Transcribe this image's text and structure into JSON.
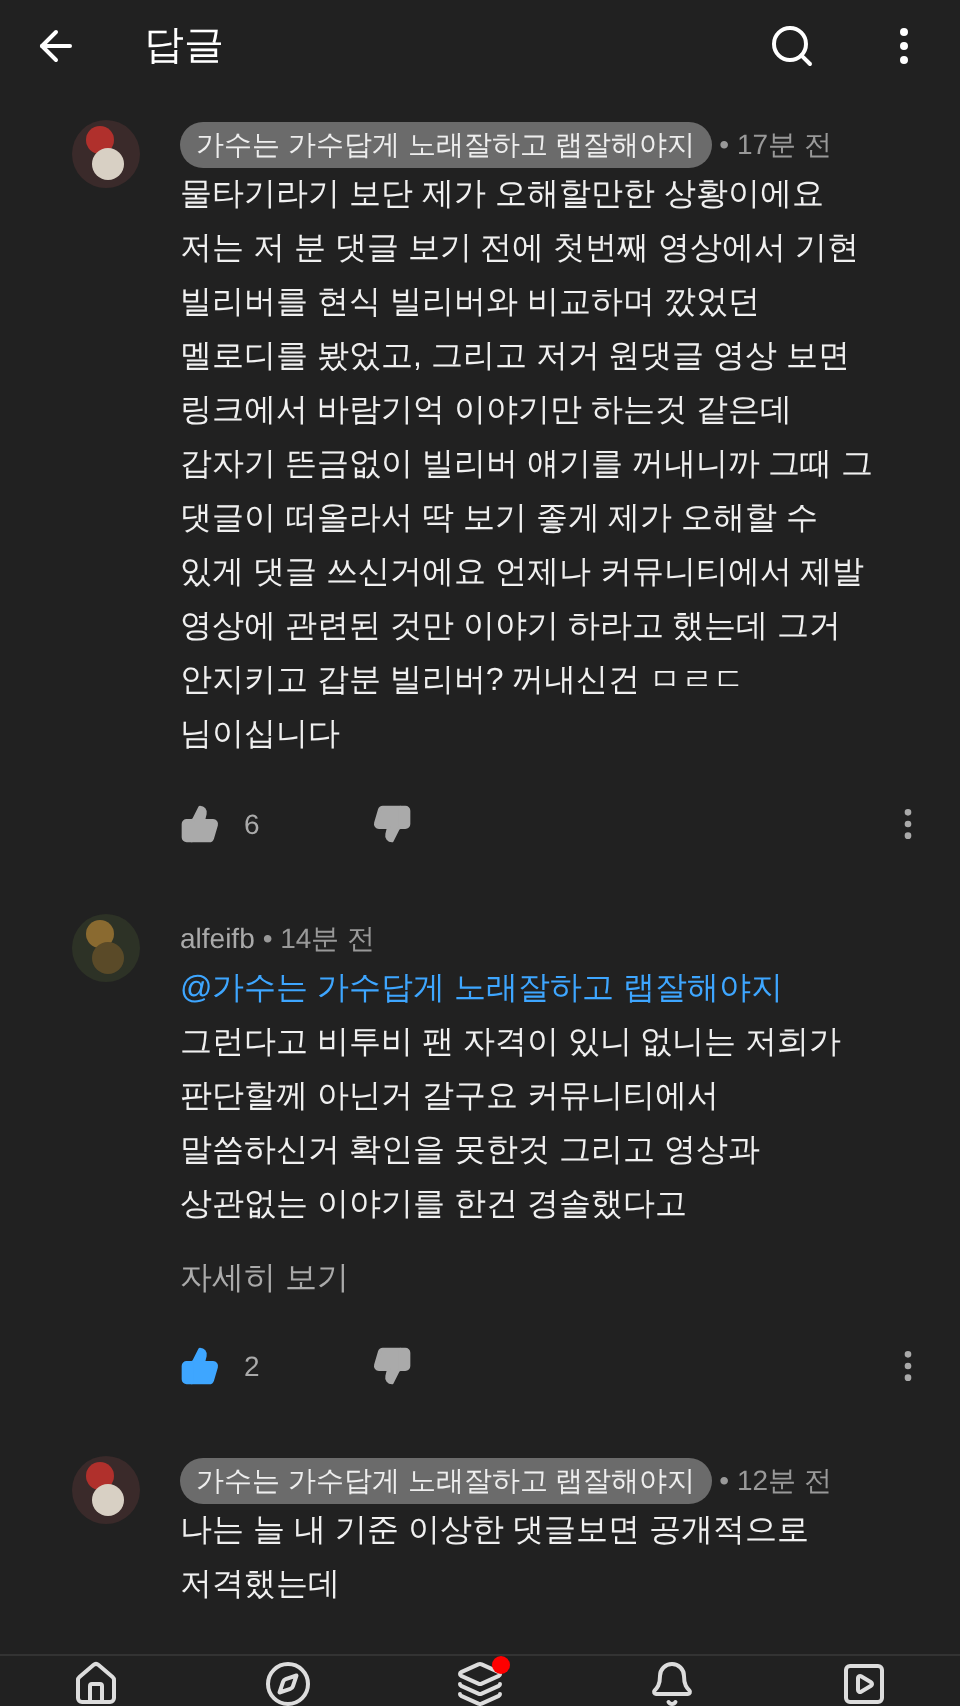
{
  "header": {
    "title": "답글"
  },
  "comments": [
    {
      "author": "가수는 가수답게 노래잘하고 랩잘해야지",
      "author_highlighted": true,
      "time": "• 17분 전",
      "body": "물타기라기 보단 제가 오해할만한 상황이에요\n저는 저 분 댓글 보기 전에 첫번째 영상에서 기현\n빌리버를 현식 빌리버와 비교하며 깠었던\n멜로디를 봤었고, 그리고 저거 원댓글 영상 보면\n링크에서 바람기억 이야기만 하는것 같은데\n갑자기 뜬금없이 빌리버 얘기를 꺼내니까 그때 그\n댓글이 떠올라서 딱 보기 좋게 제가 오해할 수\n있게 댓글 쓰신거에요 언제나 커뮤니티에서 제발\n영상에 관련된 것만 이야기 하라고 했는데 그거\n안지키고 갑분 빌리버? 꺼내신건 ㅁㄹㄷ\n님이십니다",
      "likes": "6",
      "liked": false
    },
    {
      "author": "alfeifb",
      "author_highlighted": false,
      "time": "• 14분 전",
      "mention": "@가수는 가수답게 노래잘하고 랩잘해야지",
      "body": "그런다고 비투비 팬 자격이 있니 없니는 저희가\n판단할께 아닌거 갈구요 커뮤니티에서\n말씀하신거 확인을 못한것 그리고 영상과\n상관없는 이야기를 한건 경솔했다고",
      "more": "자세히 보기",
      "likes": "2",
      "liked": true
    },
    {
      "author": "가수는 가수답게 노래잘하고 랩잘해야지",
      "author_highlighted": true,
      "time": "• 12분 전",
      "body": "나는 늘 내 기준 이상한 댓글보면 공개적으로\n저격했는데"
    }
  ],
  "nav": [
    {
      "kind": "home",
      "badge": false
    },
    {
      "kind": "explore",
      "badge": false
    },
    {
      "kind": "subscriptions",
      "badge": true
    },
    {
      "kind": "notifications",
      "badge": false
    },
    {
      "kind": "library",
      "badge": false
    }
  ]
}
